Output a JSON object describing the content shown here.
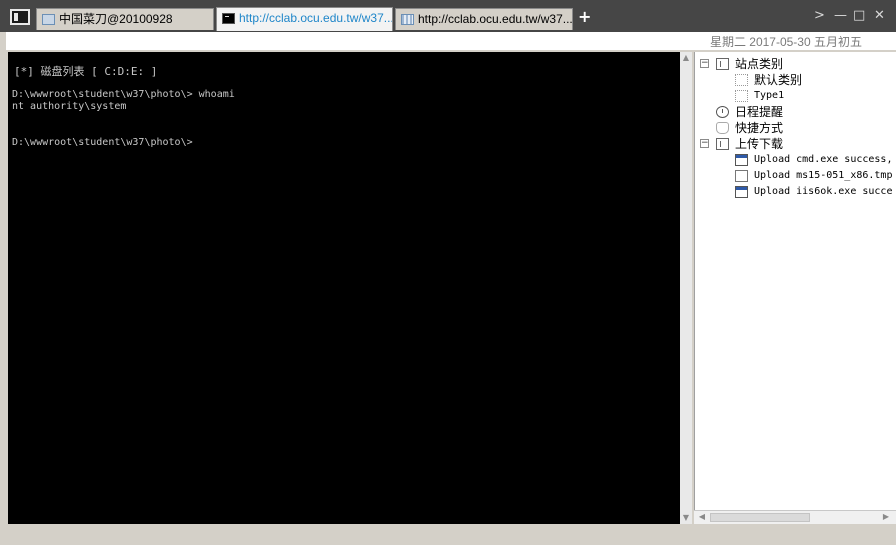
{
  "tabs": [
    {
      "label": "中国菜刀@20100928",
      "icon": "document-icon",
      "active": false
    },
    {
      "label": "http://cclab.ocu.edu.tw/w37...",
      "icon": "cmd-icon",
      "active": true
    },
    {
      "label": "http://cclab.ocu.edu.tw/w37...",
      "icon": "grid-icon",
      "active": false
    }
  ],
  "tab_add": "+",
  "window_buttons": {
    "next": ">",
    "minimize": "—",
    "maximize": "□",
    "close": "✕"
  },
  "datebar": "星期二 2017-05-30 五月初五",
  "console": {
    "lines": [
      "[*] 磁盘列表 [ C:D:E: ]",
      "D:\\wwwroot\\student\\w37\\photo\\> whoami",
      "nt authority\\system",
      "D:\\wwwroot\\student\\w37\\photo\\>"
    ]
  },
  "tree": {
    "site_category": "站点类别",
    "default_category": "默认类别",
    "type1": "Type1",
    "schedule": "日程提醒",
    "shortcuts": "快捷方式",
    "upload_download": "上传下载",
    "uploads": [
      "Upload cmd.exe success,",
      "Upload ms15-051_x86.tmp",
      "Upload iis6ok.exe succe"
    ]
  },
  "colors": {
    "active_tab_text": "#1f86c9",
    "console_bg": "#000000",
    "titlebar": "#464646"
  }
}
